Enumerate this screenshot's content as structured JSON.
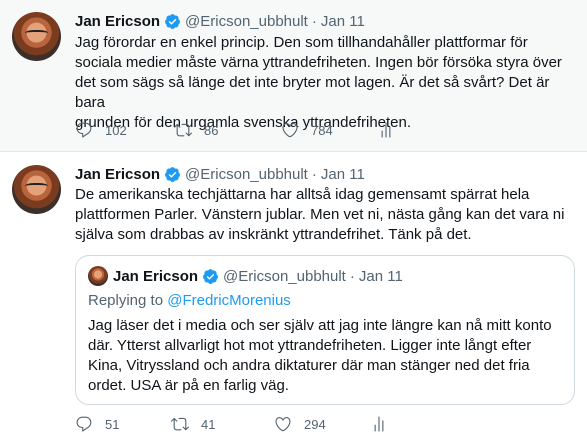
{
  "tweet1": {
    "name": "Jan Ericson",
    "handle": "@Ericson_ubbhult",
    "separator": "·",
    "date": "Jan 11",
    "text": "Jag förordar en enkel princip. Den  som tillhandahåller plattformar för\nsociala medier måste värna yttrandefriheten. Ingen bör försöka  styra över\ndet som sägs så länge det inte bryter mot lagen. Är det så svårt? Det är bara\ngrunden för den urgamla svenska yttrandefriheten.",
    "replies": "102",
    "retweets": "86",
    "likes": "784"
  },
  "tweet2": {
    "name": "Jan Ericson",
    "handle": "@Ericson_ubbhult",
    "separator": "·",
    "date": "Jan 11",
    "text": "De amerikanska techjättarna har alltså idag gemensamt spärrat hela\nplattformen Parler. Vänstern jublar. Men vet ni, nästa gång kan det vara ni\nsjälva som drabbas av inskränkt yttrandefrihet. Tänk på det.",
    "replies": "51",
    "retweets": "41",
    "likes": "294",
    "quote": {
      "name": "Jan Ericson",
      "handle": "@Ericson_ubbhult",
      "separator": "·",
      "date": "Jan 11",
      "replying_prefix": "Replying to ",
      "replying_to": "@FredricMorenius",
      "text": "Jag läser det i media och ser själv att jag inte längre kan nå mitt konto\ndär. Ytterst allvarligt hot mot yttrandefriheten. Ligger inte långt efter\nKina, Vitryssland och andra diktaturer där man stänger ned det fria\nordet. USA är på en farlig väg."
    }
  },
  "icons": {
    "verified": "verified-badge-icon",
    "reply": "reply-icon",
    "retweet": "retweet-icon",
    "like": "heart-icon",
    "share": "analytics-icon"
  },
  "colors": {
    "verified": "#1d9bf0",
    "mention": "#1d9bf0",
    "secondary_text": "#536471",
    "highlight_background": "#f7f9f9"
  }
}
